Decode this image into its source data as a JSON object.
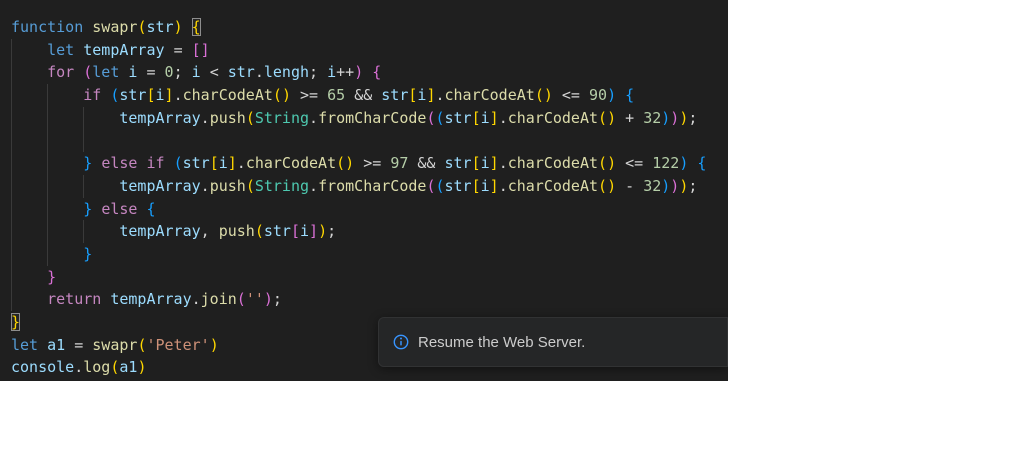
{
  "palette": {
    "editor_background": "#1f1f1f",
    "toast_background": "#252627",
    "accent_info": "#3794ff",
    "keyword": "#569cd6",
    "control_keyword": "#c586c0",
    "function_name": "#dcdcaa",
    "variable": "#9cdcfe",
    "class_name": "#4ec9b0",
    "number": "#b5cea8",
    "string": "#ce9178",
    "operator": "#d4d4d4",
    "bracket_gold": "#ffd700",
    "bracket_pink": "#da70d6",
    "bracket_blue": "#179fff"
  },
  "editor": {
    "lines": [
      {
        "tokens": [
          [
            "function",
            "kw"
          ],
          [
            " ",
            "pl"
          ],
          [
            "swapr",
            "fn"
          ],
          [
            "(",
            "b1"
          ],
          [
            "str",
            "var"
          ],
          [
            ")",
            "b1"
          ],
          [
            " ",
            "pl"
          ],
          [
            "{",
            "b1 bm"
          ]
        ]
      },
      {
        "tokens": [
          [
            "    ",
            "pl"
          ],
          [
            "let",
            "kw"
          ],
          [
            " ",
            "pl"
          ],
          [
            "tempArray",
            "var"
          ],
          [
            " ",
            "pl"
          ],
          [
            "=",
            "op"
          ],
          [
            " ",
            "pl"
          ],
          [
            "[]",
            "b2"
          ]
        ]
      },
      {
        "tokens": [
          [
            "    ",
            "pl"
          ],
          [
            "for",
            "ctrl"
          ],
          [
            " ",
            "pl"
          ],
          [
            "(",
            "b2"
          ],
          [
            "let",
            "kw"
          ],
          [
            " ",
            "pl"
          ],
          [
            "i",
            "var"
          ],
          [
            " ",
            "pl"
          ],
          [
            "=",
            "op"
          ],
          [
            " ",
            "pl"
          ],
          [
            "0",
            "num"
          ],
          [
            ";",
            "op"
          ],
          [
            " ",
            "pl"
          ],
          [
            "i",
            "var"
          ],
          [
            " ",
            "pl"
          ],
          [
            "<",
            "op"
          ],
          [
            " ",
            "pl"
          ],
          [
            "str",
            "var"
          ],
          [
            ".",
            "op"
          ],
          [
            "lengh",
            "var"
          ],
          [
            ";",
            "op"
          ],
          [
            " ",
            "pl"
          ],
          [
            "i",
            "var"
          ],
          [
            "++",
            "op"
          ],
          [
            ")",
            "b2"
          ],
          [
            " ",
            "pl"
          ],
          [
            "{",
            "b2"
          ]
        ]
      },
      {
        "tokens": [
          [
            "        ",
            "pl"
          ],
          [
            "if",
            "ctrl"
          ],
          [
            " ",
            "pl"
          ],
          [
            "(",
            "b3"
          ],
          [
            "str",
            "var"
          ],
          [
            "[",
            "b1"
          ],
          [
            "i",
            "var"
          ],
          [
            "]",
            "b1"
          ],
          [
            ".",
            "op"
          ],
          [
            "charCodeAt",
            "fn"
          ],
          [
            "(",
            "b1"
          ],
          [
            ")",
            "b1"
          ],
          [
            " ",
            "pl"
          ],
          [
            ">=",
            "op"
          ],
          [
            " ",
            "pl"
          ],
          [
            "65",
            "num"
          ],
          [
            " ",
            "pl"
          ],
          [
            "&&",
            "op"
          ],
          [
            " ",
            "pl"
          ],
          [
            "str",
            "var"
          ],
          [
            "[",
            "b1"
          ],
          [
            "i",
            "var"
          ],
          [
            "]",
            "b1"
          ],
          [
            ".",
            "op"
          ],
          [
            "charCodeAt",
            "fn"
          ],
          [
            "(",
            "b1"
          ],
          [
            ")",
            "b1"
          ],
          [
            " ",
            "pl"
          ],
          [
            "<=",
            "op"
          ],
          [
            " ",
            "pl"
          ],
          [
            "90",
            "num"
          ],
          [
            ")",
            "b3"
          ],
          [
            " ",
            "pl"
          ],
          [
            "{",
            "b3"
          ]
        ]
      },
      {
        "tokens": [
          [
            "            ",
            "pl"
          ],
          [
            "tempArray",
            "var"
          ],
          [
            ".",
            "op"
          ],
          [
            "push",
            "fn"
          ],
          [
            "(",
            "b1"
          ],
          [
            "String",
            "cls"
          ],
          [
            ".",
            "op"
          ],
          [
            "fromCharCode",
            "fn"
          ],
          [
            "(",
            "b2"
          ],
          [
            "(",
            "b3"
          ],
          [
            "str",
            "var"
          ],
          [
            "[",
            "b1"
          ],
          [
            "i",
            "var"
          ],
          [
            "]",
            "b1"
          ],
          [
            ".",
            "op"
          ],
          [
            "charCodeAt",
            "fn"
          ],
          [
            "(",
            "b1"
          ],
          [
            ")",
            "b1"
          ],
          [
            " ",
            "pl"
          ],
          [
            "+",
            "op"
          ],
          [
            " ",
            "pl"
          ],
          [
            "32",
            "num"
          ],
          [
            ")",
            "b3"
          ],
          [
            ")",
            "b2"
          ],
          [
            ")",
            "b1"
          ],
          [
            ";",
            "op"
          ]
        ]
      },
      {
        "tokens": []
      },
      {
        "tokens": [
          [
            "        ",
            "pl"
          ],
          [
            "}",
            "b3"
          ],
          [
            " ",
            "pl"
          ],
          [
            "else",
            "ctrl"
          ],
          [
            " ",
            "pl"
          ],
          [
            "if",
            "ctrl"
          ],
          [
            " ",
            "pl"
          ],
          [
            "(",
            "b3"
          ],
          [
            "str",
            "var"
          ],
          [
            "[",
            "b1"
          ],
          [
            "i",
            "var"
          ],
          [
            "]",
            "b1"
          ],
          [
            ".",
            "op"
          ],
          [
            "charCodeAt",
            "fn"
          ],
          [
            "(",
            "b1"
          ],
          [
            ")",
            "b1"
          ],
          [
            " ",
            "pl"
          ],
          [
            ">=",
            "op"
          ],
          [
            " ",
            "pl"
          ],
          [
            "97",
            "num"
          ],
          [
            " ",
            "pl"
          ],
          [
            "&&",
            "op"
          ],
          [
            " ",
            "pl"
          ],
          [
            "str",
            "var"
          ],
          [
            "[",
            "b1"
          ],
          [
            "i",
            "var"
          ],
          [
            "]",
            "b1"
          ],
          [
            ".",
            "op"
          ],
          [
            "charCodeAt",
            "fn"
          ],
          [
            "(",
            "b1"
          ],
          [
            ")",
            "b1"
          ],
          [
            " ",
            "pl"
          ],
          [
            "<=",
            "op"
          ],
          [
            " ",
            "pl"
          ],
          [
            "122",
            "num"
          ],
          [
            ")",
            "b3"
          ],
          [
            " ",
            "pl"
          ],
          [
            "{",
            "b3"
          ]
        ]
      },
      {
        "tokens": [
          [
            "            ",
            "pl"
          ],
          [
            "tempArray",
            "var"
          ],
          [
            ".",
            "op"
          ],
          [
            "push",
            "fn"
          ],
          [
            "(",
            "b1"
          ],
          [
            "String",
            "cls"
          ],
          [
            ".",
            "op"
          ],
          [
            "fromCharCode",
            "fn"
          ],
          [
            "(",
            "b2"
          ],
          [
            "(",
            "b3"
          ],
          [
            "str",
            "var"
          ],
          [
            "[",
            "b1"
          ],
          [
            "i",
            "var"
          ],
          [
            "]",
            "b1"
          ],
          [
            ".",
            "op"
          ],
          [
            "charCodeAt",
            "fn"
          ],
          [
            "(",
            "b1"
          ],
          [
            ")",
            "b1"
          ],
          [
            " ",
            "pl"
          ],
          [
            "-",
            "op"
          ],
          [
            " ",
            "pl"
          ],
          [
            "32",
            "num"
          ],
          [
            ")",
            "b3"
          ],
          [
            ")",
            "b2"
          ],
          [
            ")",
            "b1"
          ],
          [
            ";",
            "op"
          ]
        ]
      },
      {
        "tokens": [
          [
            "        ",
            "pl"
          ],
          [
            "}",
            "b3"
          ],
          [
            " ",
            "pl"
          ],
          [
            "else",
            "ctrl"
          ],
          [
            " ",
            "pl"
          ],
          [
            "{",
            "b3"
          ]
        ]
      },
      {
        "tokens": [
          [
            "            ",
            "pl"
          ],
          [
            "tempArray",
            "var"
          ],
          [
            ",",
            "op"
          ],
          [
            " ",
            "pl"
          ],
          [
            "push",
            "fn"
          ],
          [
            "(",
            "b1"
          ],
          [
            "str",
            "var"
          ],
          [
            "[",
            "b2"
          ],
          [
            "i",
            "var"
          ],
          [
            "]",
            "b2"
          ],
          [
            ")",
            "b1"
          ],
          [
            ";",
            "op"
          ]
        ]
      },
      {
        "tokens": [
          [
            "        ",
            "pl"
          ],
          [
            "}",
            "b3"
          ]
        ]
      },
      {
        "tokens": [
          [
            "    ",
            "pl"
          ],
          [
            "}",
            "b2"
          ]
        ]
      },
      {
        "tokens": [
          [
            "    ",
            "pl"
          ],
          [
            "return",
            "ctrl"
          ],
          [
            " ",
            "pl"
          ],
          [
            "tempArray",
            "var"
          ],
          [
            ".",
            "op"
          ],
          [
            "join",
            "fn"
          ],
          [
            "(",
            "b2"
          ],
          [
            "''",
            "str"
          ],
          [
            ")",
            "b2"
          ],
          [
            ";",
            "op"
          ]
        ]
      },
      {
        "tokens": [
          [
            "}",
            "b1 bm"
          ]
        ]
      },
      {
        "tokens": [
          [
            "let",
            "kw"
          ],
          [
            " ",
            "pl"
          ],
          [
            "a1",
            "var"
          ],
          [
            " ",
            "pl"
          ],
          [
            "=",
            "op"
          ],
          [
            " ",
            "pl"
          ],
          [
            "swapr",
            "fn"
          ],
          [
            "(",
            "b1"
          ],
          [
            "'Peter'",
            "str"
          ],
          [
            ")",
            "b1"
          ]
        ]
      },
      {
        "tokens": [
          [
            "console",
            "var"
          ],
          [
            ".",
            "op"
          ],
          [
            "log",
            "fn"
          ],
          [
            "(",
            "b1"
          ],
          [
            "a1",
            "var"
          ],
          [
            ")",
            "b1"
          ]
        ]
      }
    ]
  },
  "notification": {
    "icon": "info-icon",
    "text": "Resume the Web Server."
  }
}
